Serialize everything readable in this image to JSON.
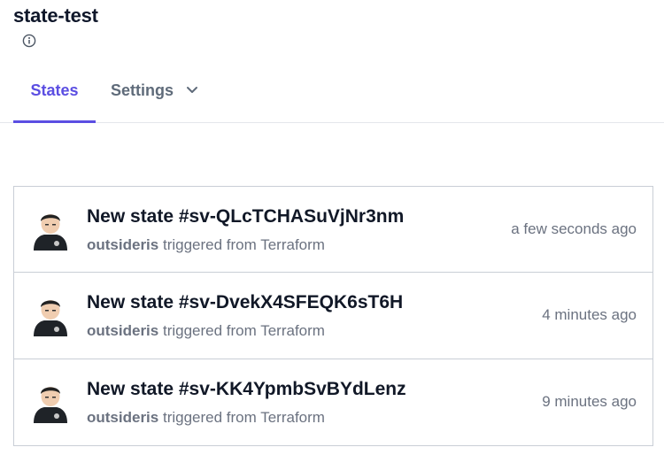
{
  "workspace": {
    "title": "state-test"
  },
  "tabs": [
    {
      "label": "States",
      "active": true
    },
    {
      "label": "Settings",
      "active": false
    }
  ],
  "colors": {
    "accent": "#5b4ee2",
    "muted": "#6b7280",
    "border": "#c9ced6"
  },
  "icons": {
    "info": "info-circle-icon",
    "chevron": "chevron-down-icon",
    "avatar": "user-avatar"
  },
  "states": [
    {
      "name": "New state #sv-QLcTCHASuVjNr3nm",
      "user": "outsideris",
      "source_text": "triggered from Terraform",
      "time": "a few seconds ago"
    },
    {
      "name": "New state #sv-DvekX4SFEQK6sT6H",
      "user": "outsideris",
      "source_text": "triggered from Terraform",
      "time": "4 minutes ago"
    },
    {
      "name": "New state #sv-KK4YpmbSvBYdLenz",
      "user": "outsideris",
      "source_text": "triggered from Terraform",
      "time": "9 minutes ago"
    }
  ]
}
